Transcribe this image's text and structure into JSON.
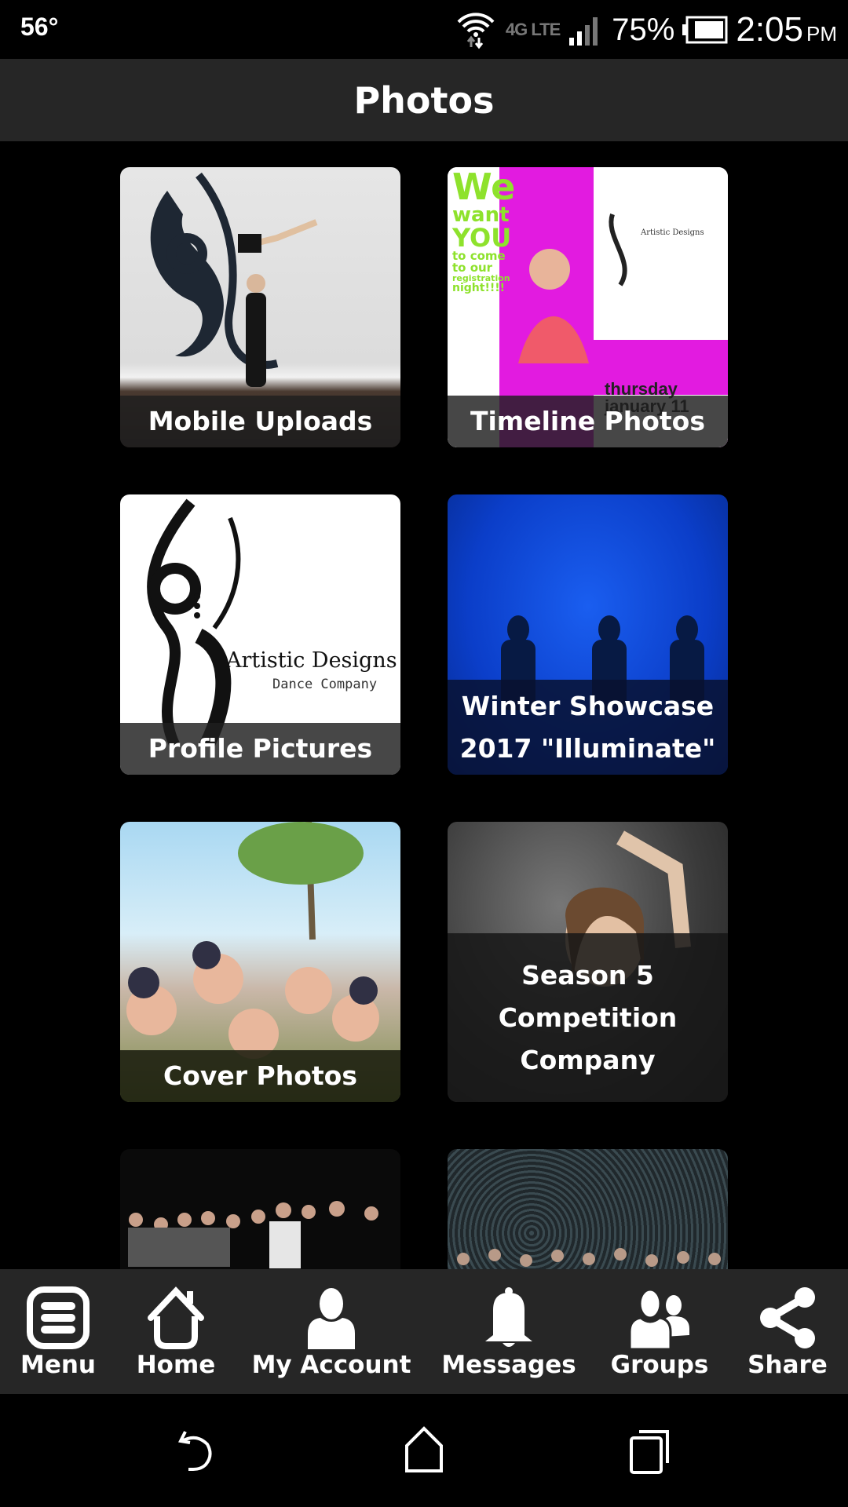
{
  "status_bar": {
    "temperature": "56°",
    "network": "4G LTE",
    "battery_percent": "75%",
    "time": "2:05",
    "ampm": "PM",
    "icons": [
      "wifi-icon",
      "data-arrows-icon",
      "lte-icon",
      "signal-icon",
      "battery-icon"
    ]
  },
  "header": {
    "title": "Photos"
  },
  "albums": [
    {
      "label": "Mobile Uploads",
      "thumbnail": "dancers-lift-wall-mural"
    },
    {
      "label": "Timeline Photos",
      "thumbnail": "registration-night-poster"
    },
    {
      "label": "Profile Pictures",
      "thumbnail": "artistic-designs-logo"
    },
    {
      "label": "Winter Showcase 2017 \"Illuminate\"",
      "thumbnail": "silhouettes-blue-stage"
    },
    {
      "label": "Cover Photos",
      "thumbnail": "group-of-dancers-outdoors"
    },
    {
      "label": "Season 5 Competition Company",
      "thumbnail": "girl-portrait-gray"
    },
    {
      "label": "",
      "thumbnail": "group-photo-stage"
    },
    {
      "label": "",
      "thumbnail": "crowd-photo"
    }
  ],
  "thumb_text": {
    "poster_lines": [
      "We",
      "want",
      "YOU",
      "to come",
      "to our",
      "registration",
      "night!!!!"
    ],
    "poster_date": "thursday january 11",
    "logo_name": "Artistic Designs",
    "logo_sub": "Dance Company"
  },
  "bottom_nav": [
    {
      "label": "Menu",
      "icon": "menu-icon"
    },
    {
      "label": "Home",
      "icon": "home-icon"
    },
    {
      "label": "My Account",
      "icon": "user-icon"
    },
    {
      "label": "Messages",
      "icon": "bell-icon"
    },
    {
      "label": "Groups",
      "icon": "group-icon"
    },
    {
      "label": "Share",
      "icon": "share-icon"
    }
  ],
  "system_nav": [
    {
      "name": "back"
    },
    {
      "name": "home"
    },
    {
      "name": "recents"
    }
  ],
  "colors": {
    "bar_background": "#262626",
    "page_background": "#000000",
    "text": "#ffffff"
  }
}
